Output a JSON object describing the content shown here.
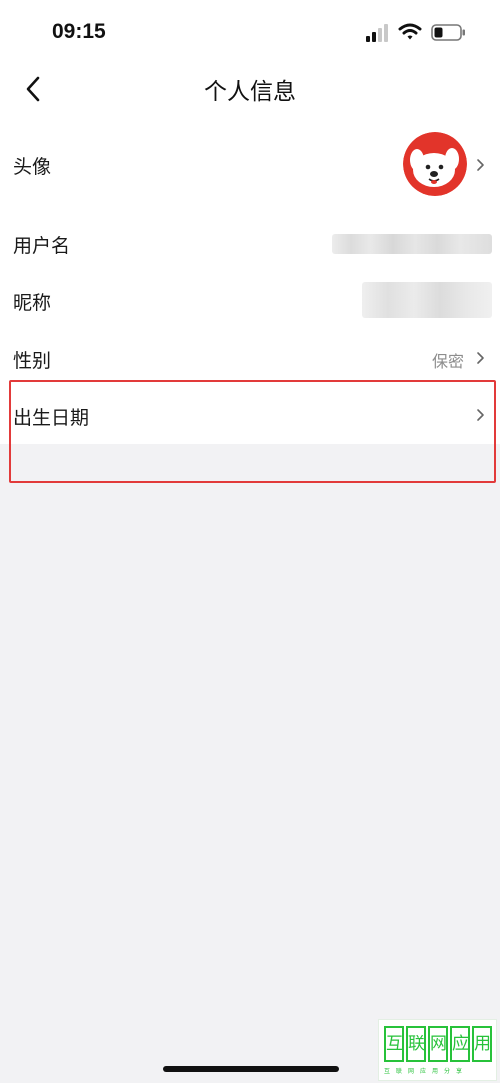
{
  "status_bar": {
    "time": "09:15"
  },
  "nav": {
    "title": "个人信息"
  },
  "rows": [
    {
      "label": "头像"
    },
    {
      "label": "用户名"
    },
    {
      "label": "昵称"
    },
    {
      "label": "性别",
      "value": "保密"
    },
    {
      "label": "出生日期"
    }
  ],
  "colors": {
    "highlight_border": "#e23a3a",
    "avatar_background": "#e2342a",
    "watermark_green": "#27c23a",
    "page_background": "#f2f2f4"
  },
  "icons": [
    "back-chevron-icon",
    "chevron-right-icon",
    "signal-icon",
    "wifi-icon",
    "battery-icon"
  ],
  "watermark": {
    "characters": [
      "互",
      "联",
      "网",
      "应",
      "用"
    ],
    "subtitle": "互联网应用分享"
  }
}
